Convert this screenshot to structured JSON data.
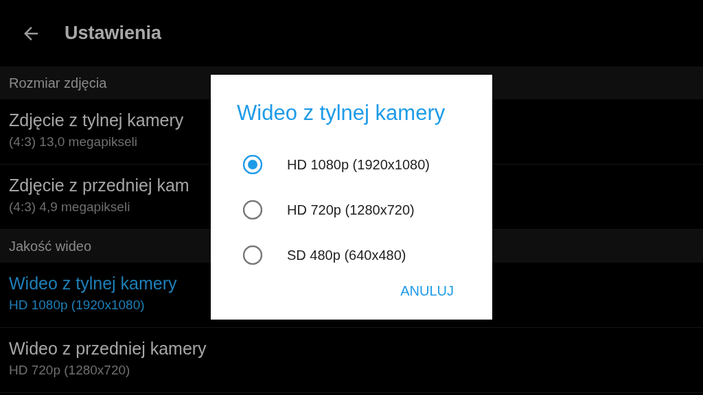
{
  "app_bar": {
    "title": "Ustawienia"
  },
  "sections": [
    {
      "header": "Rozmiar zdjęcia",
      "items": [
        {
          "title": "Zdjęcie z tylnej kamery",
          "summary": "(4:3) 13,0 megapikseli",
          "selected": false
        },
        {
          "title": "Zdjęcie z przedniej kam",
          "summary": "(4:3) 4,9 megapikseli",
          "selected": false
        }
      ]
    },
    {
      "header": "Jakość wideo",
      "items": [
        {
          "title": "Wideo z tylnej kamery",
          "summary": "HD 1080p (1920x1080)",
          "selected": true
        },
        {
          "title": "Wideo z przedniej kamery",
          "summary": "HD 720p (1280x720)",
          "selected": false
        }
      ]
    }
  ],
  "dialog": {
    "title": "Wideo z tylnej kamery",
    "options": [
      {
        "label": "HD 1080p (1920x1080)",
        "selected": true
      },
      {
        "label": "HD 720p (1280x720)",
        "selected": false
      },
      {
        "label": "SD 480p (640x480)",
        "selected": false
      }
    ],
    "cancel": "ANULUJ"
  }
}
